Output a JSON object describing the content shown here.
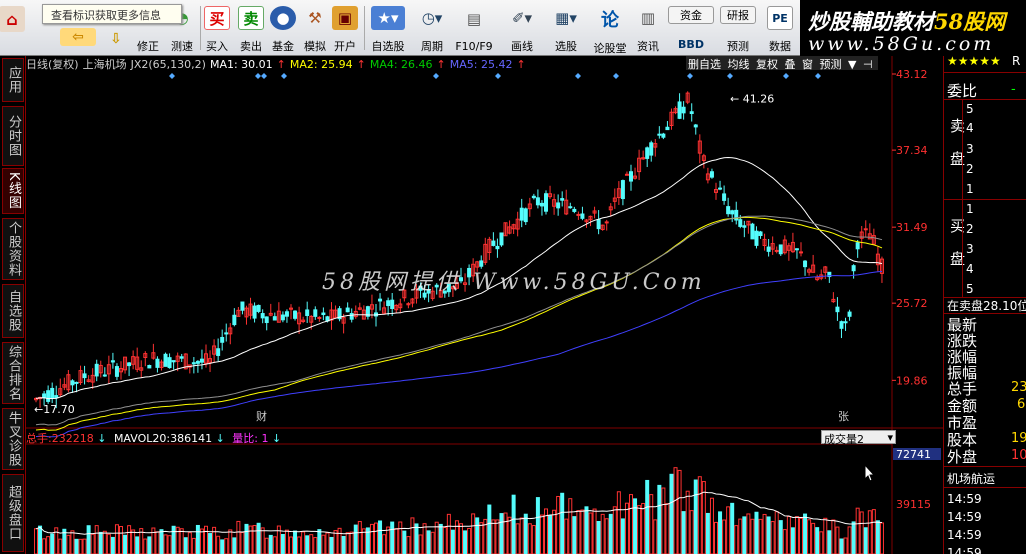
{
  "toolbar": {
    "buttons": [
      {
        "label": "修正",
        "icon": "pencil-icon"
      },
      {
        "label": "测速",
        "icon": "speed-icon"
      },
      {
        "label": "买入",
        "icon": "buy-icon",
        "icon_text": "买"
      },
      {
        "label": "卖出",
        "icon": "sell-icon",
        "icon_text": "卖"
      },
      {
        "label": "基金",
        "icon": "fund-icon"
      },
      {
        "label": "模拟",
        "icon": "hammer-icon"
      },
      {
        "label": "开户",
        "icon": "lock-icon"
      },
      {
        "label": "自选股",
        "icon": "star-icon"
      },
      {
        "label": "周期",
        "icon": "clock-icon"
      },
      {
        "label": "F10/F9",
        "icon": "document-icon"
      },
      {
        "label": "画线",
        "icon": "draw-icon"
      },
      {
        "label": "选股",
        "icon": "monitor-icon"
      },
      {
        "label": "论股堂",
        "icon": "forum-icon",
        "icon_text": "论"
      },
      {
        "label": "资讯",
        "icon": "news-icon"
      },
      {
        "label": "资金",
        "icon": "capital-icon",
        "icon_text": "资金"
      },
      {
        "label": "BBD",
        "icon": "bbd-icon"
      },
      {
        "label": "研报",
        "icon": "report-icon",
        "icon_text": "研报"
      },
      {
        "label": "预测",
        "icon": "forecast-icon"
      },
      {
        "label": "数据",
        "icon": "pe-icon",
        "icon_text": "PE"
      }
    ],
    "hint": "查看标识获取更多信息"
  },
  "watermark": {
    "line1_a": "炒股輔助教材",
    "line1_b": "58股网",
    "line2": "www.58Gu.com",
    "center": "58股网提供 Www.58GU.Com"
  },
  "left_tabs": [
    "应用",
    "分时图",
    "K线图",
    "个股资料",
    "自选股",
    "综合排名",
    "牛叉诊股",
    "超级盘口"
  ],
  "legend": {
    "period": "日线(复权)",
    "name": "上海机场",
    "indicator": "JX2(65,130,2)",
    "ma1": "MA1: 30.01",
    "ma2": "MA2: 25.94",
    "ma4": "MA4: 26.46",
    "ma5": "MA5: 25.42",
    "arrow_up": "↑"
  },
  "chart_tools": [
    "删自选",
    "均线",
    "复权",
    "叠",
    "窗",
    "预测",
    "▼",
    "⊣"
  ],
  "colors": {
    "up": "#ff3232",
    "down": "#54fcfc",
    "ma1": "#ffffff",
    "ma2": "#ffff00",
    "ma4": "#00c000",
    "ma5": "#4040ff",
    "grid": "#800000",
    "axis": "#ff3030"
  },
  "chart_data": {
    "type": "candlestick",
    "y_ticks": [
      "43.12",
      "37.34",
      "31.49",
      "25.72",
      "19.86"
    ],
    "high_label": "41.26",
    "low_label": "17.70",
    "ylim": [
      17.0,
      43.12
    ],
    "markers": [
      "财",
      "张"
    ],
    "volume": {
      "header_label": "总手:",
      "header_value": "232218",
      "mavol_label": "MAVOL20:",
      "mavol_value": "386141",
      "ratio": "量比: 1",
      "selector": "成交量2",
      "y_ticks": [
        "72741",
        "39115"
      ]
    }
  },
  "right_panel": {
    "stars": "★★★★★",
    "code_suffix": "R",
    "weibi": "委比",
    "weibi_val": "-",
    "sell_label": "卖盘",
    "buy_label": "买盘",
    "sell_levels": [
      "5",
      "4",
      "3",
      "2",
      "1"
    ],
    "buy_levels": [
      "1",
      "2",
      "3",
      "4",
      "5"
    ],
    "status": "在卖盘28.10位",
    "fields": [
      {
        "label": "最新",
        "value": ""
      },
      {
        "label": "涨跌",
        "value": ""
      },
      {
        "label": "涨幅",
        "value": ""
      },
      {
        "label": "振幅",
        "value": ""
      },
      {
        "label": "总手",
        "value": "23"
      },
      {
        "label": "金额",
        "value": "6"
      },
      {
        "label": "市盈",
        "value": ""
      },
      {
        "label": "股本",
        "value": "19"
      },
      {
        "label": "外盘",
        "value": "10"
      }
    ],
    "sector": "机场航运",
    "times": [
      "14:59",
      "14:59",
      "14:59",
      "14:59"
    ]
  }
}
